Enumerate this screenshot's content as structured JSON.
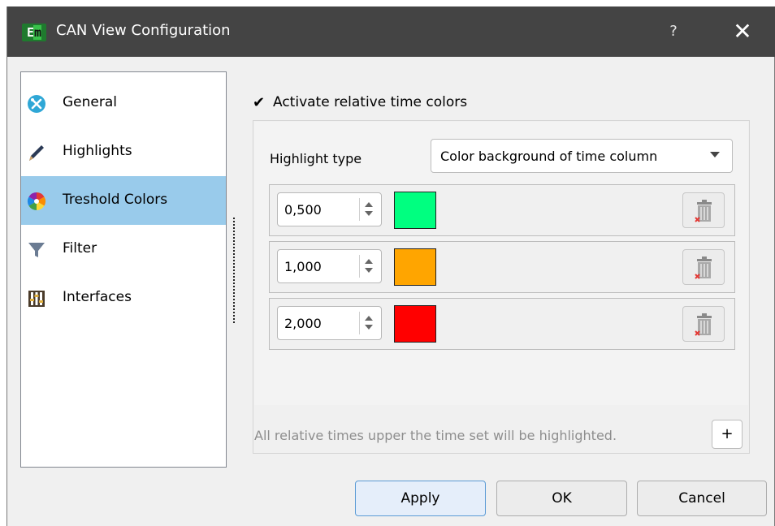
{
  "window": {
    "title": "CAN View Configuration",
    "logo_text_e": "E",
    "logo_text_m": "m",
    "help_label": "?",
    "close_label": "✕"
  },
  "sidebar": {
    "items": [
      {
        "label": "General",
        "icon": "tools-icon",
        "active": false
      },
      {
        "label": "Highlights",
        "icon": "pencil-icon",
        "active": false
      },
      {
        "label": "Treshold Colors",
        "icon": "color-wheel-icon",
        "active": true
      },
      {
        "label": "Filter",
        "icon": "funnel-icon",
        "active": false
      },
      {
        "label": "Interfaces",
        "icon": "sliders-icon",
        "active": false
      }
    ],
    "active_bg": "#99cbeb"
  },
  "settings": {
    "activate_checked": true,
    "activate_check_glyph": "✔",
    "activate_label": "Activate relative time colors",
    "highlight_type_label": "Highlight type",
    "highlight_type_value": "Color background of time column",
    "thresholds": [
      {
        "value": "0,500",
        "color": "#00ff80"
      },
      {
        "value": "1,000",
        "color": "#ffa500"
      },
      {
        "value": "2,000",
        "color": "#ff0000"
      }
    ],
    "hint": "All relative times upper the time set will be highlighted.",
    "add_label": "+"
  },
  "buttons": {
    "apply": "Apply",
    "ok": "OK",
    "cancel": "Cancel"
  }
}
